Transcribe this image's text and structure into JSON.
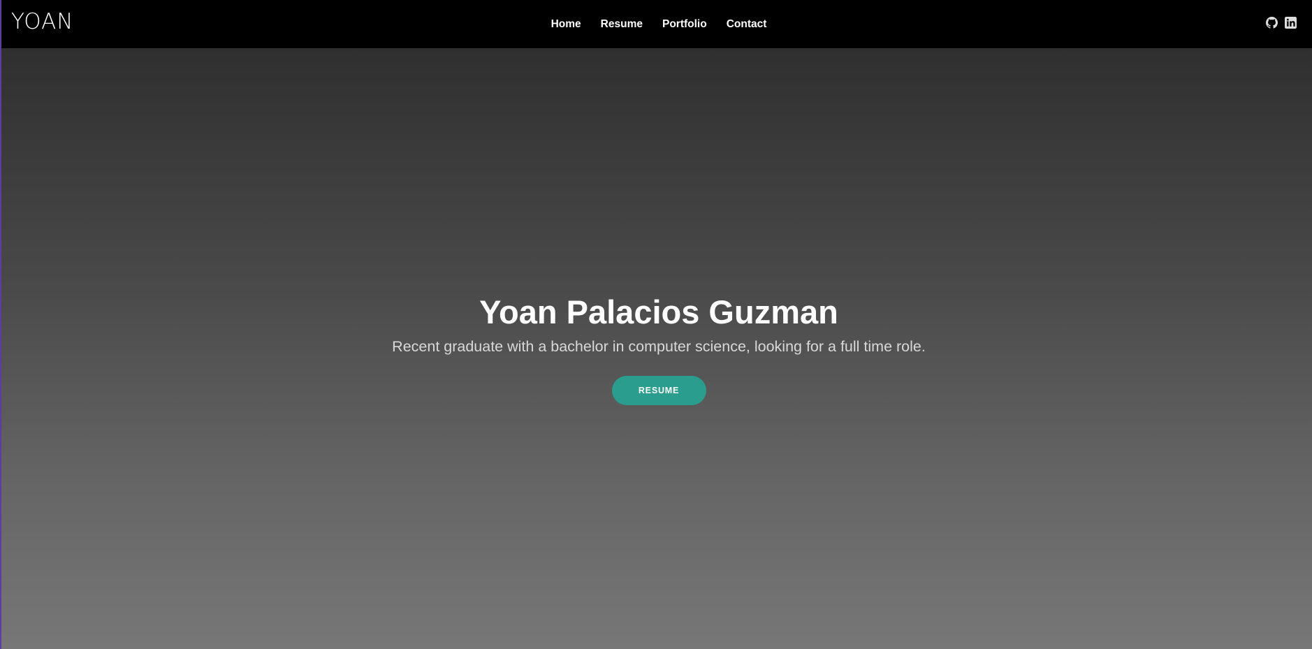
{
  "navbar": {
    "brand": "YOAN",
    "links": [
      "Home",
      "Resume",
      "Portfolio",
      "Contact"
    ],
    "social_icons": [
      "github-icon",
      "linkedin-icon"
    ]
  },
  "hero": {
    "title": "Yoan Palacios Guzman",
    "subtitle": "Recent graduate with a bachelor in computer science, looking for a full time role.",
    "button_label": "RESUME"
  },
  "colors": {
    "navbar_bg": "#000000",
    "accent": "#2a9d8f",
    "hero_gradient_top": "#2f2f2f",
    "hero_gradient_bottom": "#787777"
  }
}
